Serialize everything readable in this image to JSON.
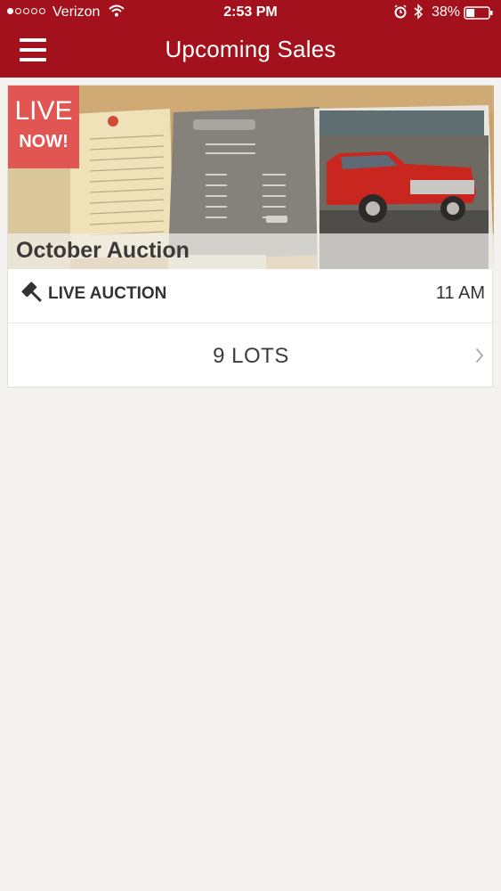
{
  "status_bar": {
    "carrier": "Verizon",
    "time": "2:53 PM",
    "battery": "38%",
    "battery_level": 0.38,
    "signal_bars_filled": 1,
    "signal_bars_total": 5
  },
  "header": {
    "title": "Upcoming Sales",
    "background": "#a3121c",
    "menu_icon": "hamburger-menu-icon"
  },
  "sale": {
    "badge_line1": "LIVE",
    "badge_line2": "NOW!",
    "badge_color": "#e15552",
    "title": "October Auction",
    "type_icon": "gavel-icon",
    "type": "LIVE AUCTION",
    "time": "11 AM",
    "lots": "9 LOTS",
    "lots_icon": "chevron-right-icon"
  }
}
